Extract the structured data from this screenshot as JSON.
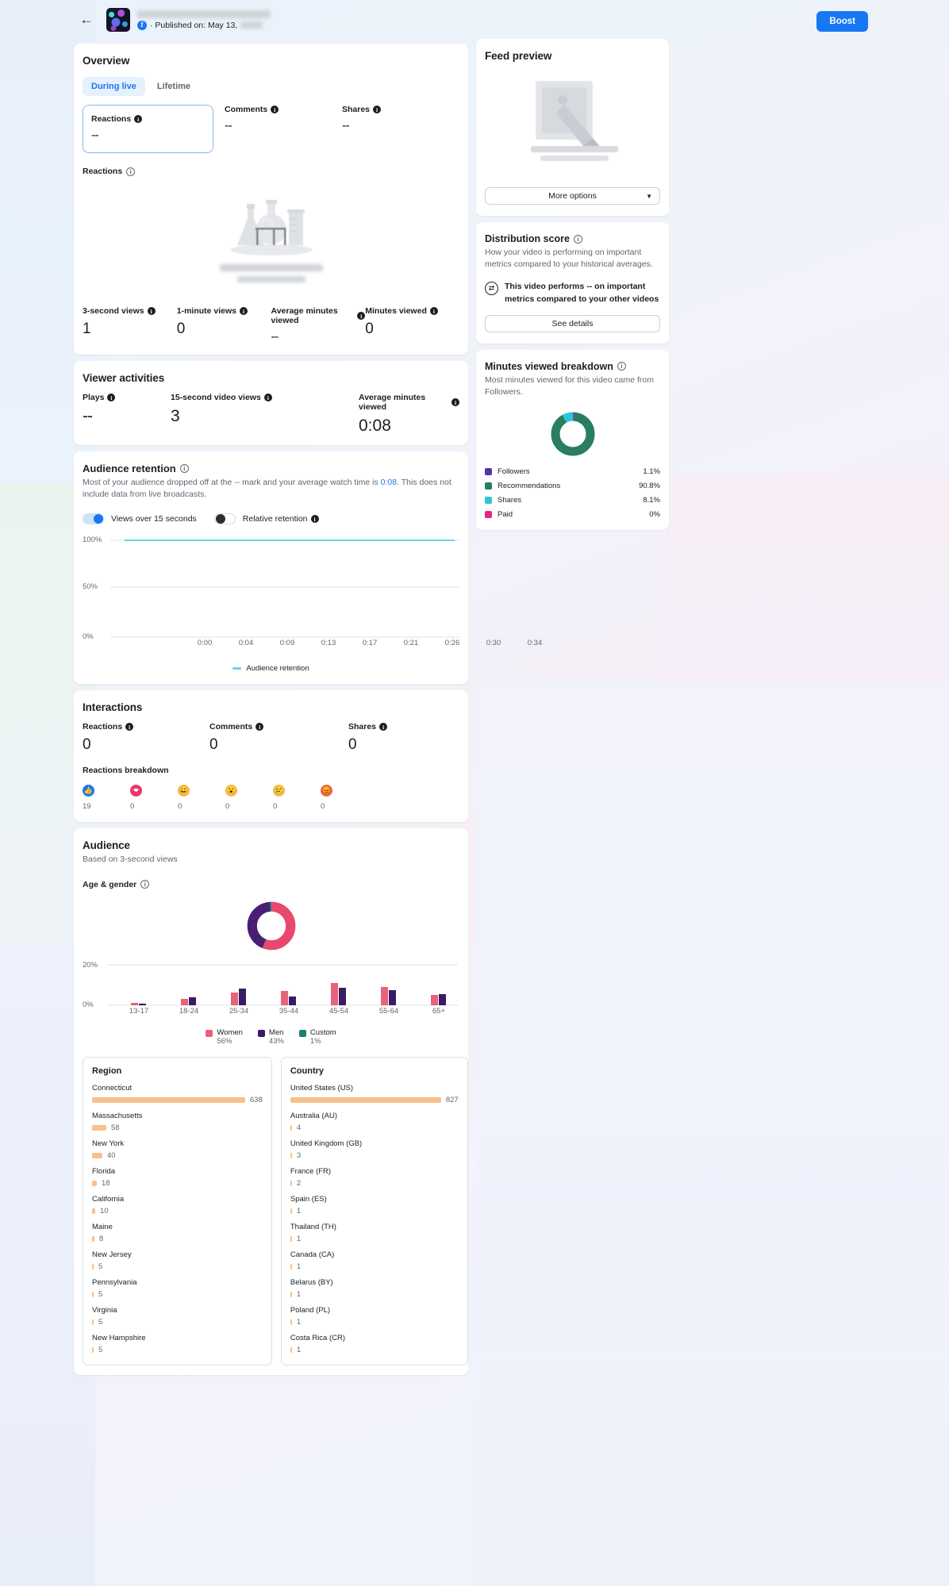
{
  "header": {
    "back_icon": "back-arrow-icon",
    "platform_icon": "facebook-icon",
    "published_label": "· Published on: May 13,",
    "boost_label": "Boost"
  },
  "overview": {
    "title": "Overview",
    "tabs": [
      {
        "label": "During live",
        "active": true
      },
      {
        "label": "Lifetime",
        "active": false
      }
    ],
    "stats": [
      {
        "label": "Reactions",
        "value": "--"
      },
      {
        "label": "Comments",
        "value": "--"
      },
      {
        "label": "Shares",
        "value": "--"
      }
    ],
    "chart_label": "Reactions",
    "views": [
      {
        "label": "3-second views",
        "value": "1"
      },
      {
        "label": "1-minute views",
        "value": "0"
      },
      {
        "label": "Average minutes viewed",
        "value": "--"
      },
      {
        "label": "Minutes viewed",
        "value": "0"
      }
    ]
  },
  "viewer_activities": {
    "title": "Viewer activities",
    "stats": [
      {
        "label": "Plays",
        "value": "--"
      },
      {
        "label": "15-second video views",
        "value": "3"
      },
      {
        "label": "Average minutes viewed",
        "value": "0:08"
      }
    ]
  },
  "audience_retention": {
    "title": "Audience retention",
    "description_a": "Most of your audience dropped off at the -- mark and your average watch time is ",
    "description_link": "0:08",
    "description_b": ". This does not include data from live broadcasts.",
    "toggles": [
      {
        "label": "Views over 15 seconds",
        "state": "on"
      },
      {
        "label": "Relative retention",
        "state": "off"
      }
    ]
  },
  "interactions": {
    "title": "Interactions",
    "stats": [
      {
        "label": "Reactions",
        "value": "0"
      },
      {
        "label": "Comments",
        "value": "0"
      },
      {
        "label": "Shares",
        "value": "0"
      }
    ],
    "breakdown_label": "Reactions breakdown",
    "reactions": [
      {
        "name": "like",
        "count": "19",
        "glyph": "👍",
        "color": "#1877f2"
      },
      {
        "name": "love",
        "count": "0",
        "glyph": "♥",
        "color": "#e8386d"
      },
      {
        "name": "haha",
        "count": "0",
        "glyph": "😂",
        "color": "#f5b544"
      },
      {
        "name": "wow",
        "count": "0",
        "glyph": "😮",
        "color": "#f5b544"
      },
      {
        "name": "sad",
        "count": "0",
        "glyph": "😢",
        "color": "#f5b544"
      },
      {
        "name": "angry",
        "count": "0",
        "glyph": "😡",
        "color": "#e8693c"
      }
    ]
  },
  "audience": {
    "title": "Audience",
    "subtitle": "Based on 3-second views",
    "age_gender_label": "Age & gender",
    "region": {
      "title": "Region",
      "items": [
        {
          "name": "Connecticut",
          "value": "638"
        },
        {
          "name": "Massachusetts",
          "value": "58"
        },
        {
          "name": "New York",
          "value": "40"
        },
        {
          "name": "Florida",
          "value": "18"
        },
        {
          "name": "California",
          "value": "10"
        },
        {
          "name": "Maine",
          "value": "8"
        },
        {
          "name": "New Jersey",
          "value": "5"
        },
        {
          "name": "Pennsylvania",
          "value": "5"
        },
        {
          "name": "Virginia",
          "value": "5"
        },
        {
          "name": "New Hampshire",
          "value": "5"
        }
      ]
    },
    "country": {
      "title": "Country",
      "items": [
        {
          "name": "United States (US)",
          "value": "827"
        },
        {
          "name": "Australia (AU)",
          "value": "4"
        },
        {
          "name": "United Kingdom (GB)",
          "value": "3"
        },
        {
          "name": "France (FR)",
          "value": "2"
        },
        {
          "name": "Spain (ES)",
          "value": "1"
        },
        {
          "name": "Thailand (TH)",
          "value": "1"
        },
        {
          "name": "Canada (CA)",
          "value": "1"
        },
        {
          "name": "Belarus (BY)",
          "value": "1"
        },
        {
          "name": "Poland (PL)",
          "value": "1"
        },
        {
          "name": "Costa Rica (CR)",
          "value": "1"
        }
      ]
    }
  },
  "feed_preview": {
    "title": "Feed preview",
    "more_options_label": "More options",
    "caret_icon": "chevron-down-icon"
  },
  "distribution_score": {
    "title": "Distribution score",
    "description": "How your video is performing on important metrics compared to your historical averages.",
    "callout": "This video performs -- on important metrics compared to your other videos",
    "button_label": "See details",
    "icon": "compare-arrows-icon"
  },
  "minutes_viewed": {
    "title": "Minutes viewed breakdown",
    "subtitle": "Most minutes viewed for this video came from Followers.",
    "legend": [
      {
        "name": "Followers",
        "value": "1.1%",
        "color": "#5533a8"
      },
      {
        "name": "Recommendations",
        "value": "90.8%",
        "color": "#2a7d5f"
      },
      {
        "name": "Shares",
        "value": "8.1%",
        "color": "#2ec5d8"
      },
      {
        "name": "Paid",
        "value": "0%",
        "color": "#e6267f"
      }
    ]
  },
  "chart_data": [
    {
      "type": "line",
      "name": "audience-retention",
      "title": "Audience retention",
      "xlabel": "",
      "ylabel": "",
      "ylim": [
        0,
        100
      ],
      "ytick_labels": [
        "100%",
        "50%",
        "0%"
      ],
      "ytick_values": [
        100,
        50,
        0
      ],
      "x": [
        "0:00",
        "0:04",
        "0:09",
        "0:13",
        "0:17",
        "0:21",
        "0:26",
        "0:30",
        "0:34"
      ],
      "series": [
        {
          "name": "Audience retention",
          "color": "#6fd2e8",
          "values": [
            100,
            100,
            100,
            100,
            100,
            100,
            100,
            100,
            100
          ]
        }
      ],
      "legend": [
        "Audience retention"
      ],
      "legend_position": "bottom",
      "grid": true
    },
    {
      "type": "bar",
      "name": "age-gender",
      "title": "Age & gender",
      "categories": [
        "13-17",
        "18-24",
        "25-34",
        "35-44",
        "45-54",
        "55-64",
        "65+"
      ],
      "ylabel": "",
      "ylim": [
        0,
        20
      ],
      "ytick_labels": [
        "20%",
        "0%"
      ],
      "ytick_values": [
        20,
        0
      ],
      "series": [
        {
          "name": "Women",
          "color": "#e8627b",
          "share": "56%",
          "values": [
            0.6,
            2.2,
            6.0,
            7.0,
            11.5,
            9.5,
            5.0
          ]
        },
        {
          "name": "Men",
          "color": "#3a1a66",
          "share": "43%",
          "values": [
            0.4,
            2.6,
            8.0,
            4.2,
            8.5,
            7.5,
            5.5
          ]
        },
        {
          "name": "Custom",
          "color": "#1b7f70",
          "share": "1%",
          "values": [
            0,
            0,
            0,
            0,
            0,
            0,
            0
          ]
        }
      ],
      "legend": [
        "Women",
        "Men",
        "Custom"
      ],
      "legend_position": "bottom",
      "grid": true
    },
    {
      "type": "pie",
      "name": "age-gender-donut",
      "title": "Age & gender donut",
      "labels": [
        "Women",
        "Men",
        "Custom"
      ],
      "values": [
        56,
        43,
        1
      ],
      "colors": [
        "#e8486b",
        "#4a1f73",
        "#1b7f70"
      ]
    },
    {
      "type": "pie",
      "name": "minutes-viewed-breakdown",
      "title": "Minutes viewed breakdown",
      "labels": [
        "Followers",
        "Recommendations",
        "Shares",
        "Paid"
      ],
      "values": [
        1.1,
        90.8,
        8.1,
        0
      ],
      "colors": [
        "#5533a8",
        "#2a7d5f",
        "#2ec5d8",
        "#e6267f"
      ]
    },
    {
      "type": "bar",
      "name": "region-breakdown",
      "title": "Region",
      "orientation": "horizontal",
      "categories": [
        "Connecticut",
        "Massachusetts",
        "New York",
        "Florida",
        "California",
        "Maine",
        "New Jersey",
        "Pennsylvania",
        "Virginia",
        "New Hampshire"
      ],
      "values": [
        638,
        58,
        40,
        18,
        10,
        8,
        5,
        5,
        5,
        5
      ],
      "color": "#f8c08a"
    },
    {
      "type": "bar",
      "name": "country-breakdown",
      "title": "Country",
      "orientation": "horizontal",
      "categories": [
        "United States (US)",
        "Australia (AU)",
        "United Kingdom (GB)",
        "France (FR)",
        "Spain (ES)",
        "Thailand (TH)",
        "Canada (CA)",
        "Belarus (BY)",
        "Poland (PL)",
        "Costa Rica (CR)"
      ],
      "values": [
        827,
        4,
        3,
        2,
        1,
        1,
        1,
        1,
        1,
        1
      ],
      "color": "#f8c08a"
    }
  ]
}
